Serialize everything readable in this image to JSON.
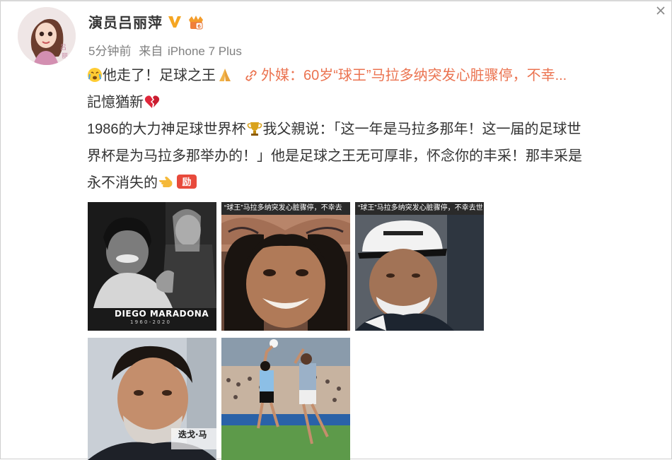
{
  "post": {
    "author": "演员吕丽萍",
    "time": "5分钟前",
    "source_prefix": "来自",
    "device": "iPhone 7 Plus"
  },
  "content": {
    "line1_text": "他走了！足球之王",
    "link_text": "外媒：60岁“球王”马拉多纳突发心脏骤停，不幸...",
    "line2_text": "記憶猶新",
    "line3_a": "1986的大力神足球世界杯",
    "line3_b": "我父親说：「这一年是马拉多那年！这一届的足球世",
    "line4": "界杯是为马拉多那举办的！」他是足球之王无可厚非，怀念你的丰采！那丰采是",
    "line5": "永不消失的"
  },
  "images": {
    "img1_name": "DIEGO MARADONA",
    "img1_years": "1 9 6 0 - 2 0 2 0",
    "img2_caption": "“球王”马拉多纳突发心脏骤停，不幸去",
    "img3_caption": "“球王”马拉多纳突发心脏骤停，不幸去世",
    "img4_caption": "迭戈·马"
  },
  "colors": {
    "link": "#eb7350",
    "verified": "#f5a623",
    "meta": "#808080"
  },
  "icons": [
    "close-icon",
    "verified-v-icon",
    "crown-badge-icon",
    "crying-emoji",
    "pray-emoji",
    "link-icon",
    "broken-heart-emoji",
    "trophy-emoji",
    "hand-point-emoji",
    "cheer-emoji"
  ]
}
